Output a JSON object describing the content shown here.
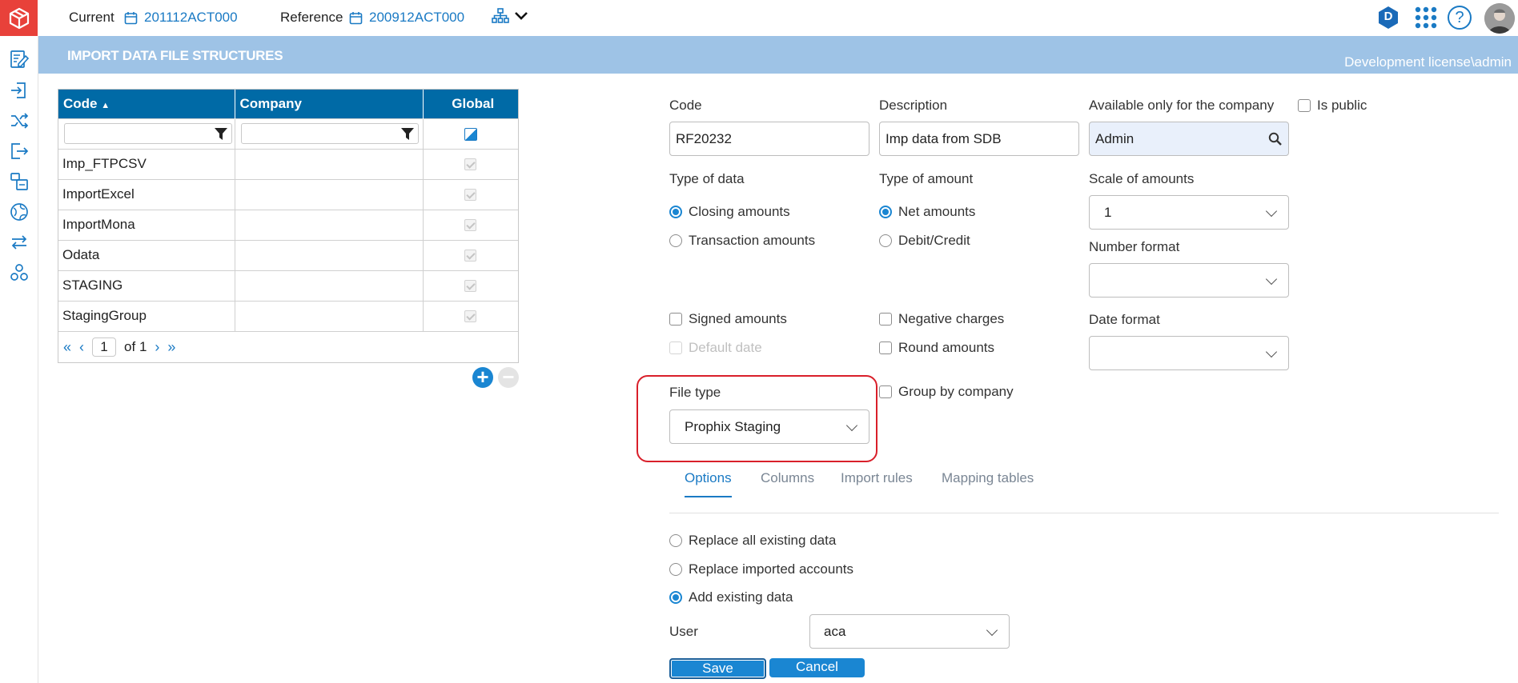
{
  "topbar": {
    "current_label": "Current",
    "current_value": "201112ACT000",
    "reference_label": "Reference",
    "reference_value": "200912ACT000",
    "badge_letter": "D",
    "help_glyph": "?"
  },
  "rail": {
    "icons": [
      "edit-report-icon",
      "import-icon",
      "shuffle-icon",
      "export-icon",
      "structure-icon",
      "globe-icon",
      "swap-icon",
      "cluster-icon"
    ]
  },
  "titlebar": {
    "title": "IMPORT DATA FILE STRUCTURES",
    "license": "Development license\\admin"
  },
  "grid": {
    "columns": [
      "Code",
      "Company",
      "Global"
    ],
    "rows": [
      {
        "code": "Imp_FTPCSV",
        "company": ""
      },
      {
        "code": "ImportExcel",
        "company": ""
      },
      {
        "code": "ImportMona",
        "company": ""
      },
      {
        "code": "Odata",
        "company": ""
      },
      {
        "code": "STAGING",
        "company": ""
      },
      {
        "code": "StagingGroup",
        "company": ""
      }
    ],
    "pager": {
      "page": "1",
      "of_label": "of",
      "total": "1"
    }
  },
  "form": {
    "code_label": "Code",
    "code_value": "RF20232",
    "description_label": "Description",
    "description_value": "Imp data from SDB",
    "company_label": "Available only for the company",
    "company_value": "Admin",
    "is_public_label": "Is public",
    "type_of_data_label": "Type of data",
    "closing_amounts": "Closing amounts",
    "transaction_amounts": "Transaction amounts",
    "type_of_amount_label": "Type of amount",
    "net_amounts": "Net amounts",
    "debit_credit": "Debit/Credit",
    "scale_label": "Scale of amounts",
    "scale_value": "1",
    "number_format_label": "Number format",
    "number_format_value": "",
    "date_format_label": "Date format",
    "date_format_value": "",
    "signed_amounts": "Signed amounts",
    "default_date": "Default date",
    "negative_charges": "Negative charges",
    "round_amounts": "Round amounts",
    "group_by_company": "Group by company",
    "file_type_label": "File type",
    "file_type_value": "Prophix Staging"
  },
  "tabs": [
    "Options",
    "Columns",
    "Import rules",
    "Mapping tables"
  ],
  "options": {
    "replace_all": "Replace all existing data",
    "replace_imported": "Replace imported accounts",
    "add_existing": "Add existing data",
    "user_label": "User",
    "user_value": "aca"
  },
  "buttons": {
    "save": "Save",
    "cancel": "Cancel"
  },
  "colors": {
    "accent": "#1a86d2",
    "header": "#006aa6",
    "titlebar": "#9ec3e6",
    "logo": "#e8413a",
    "highlight": "#d91f2a"
  }
}
